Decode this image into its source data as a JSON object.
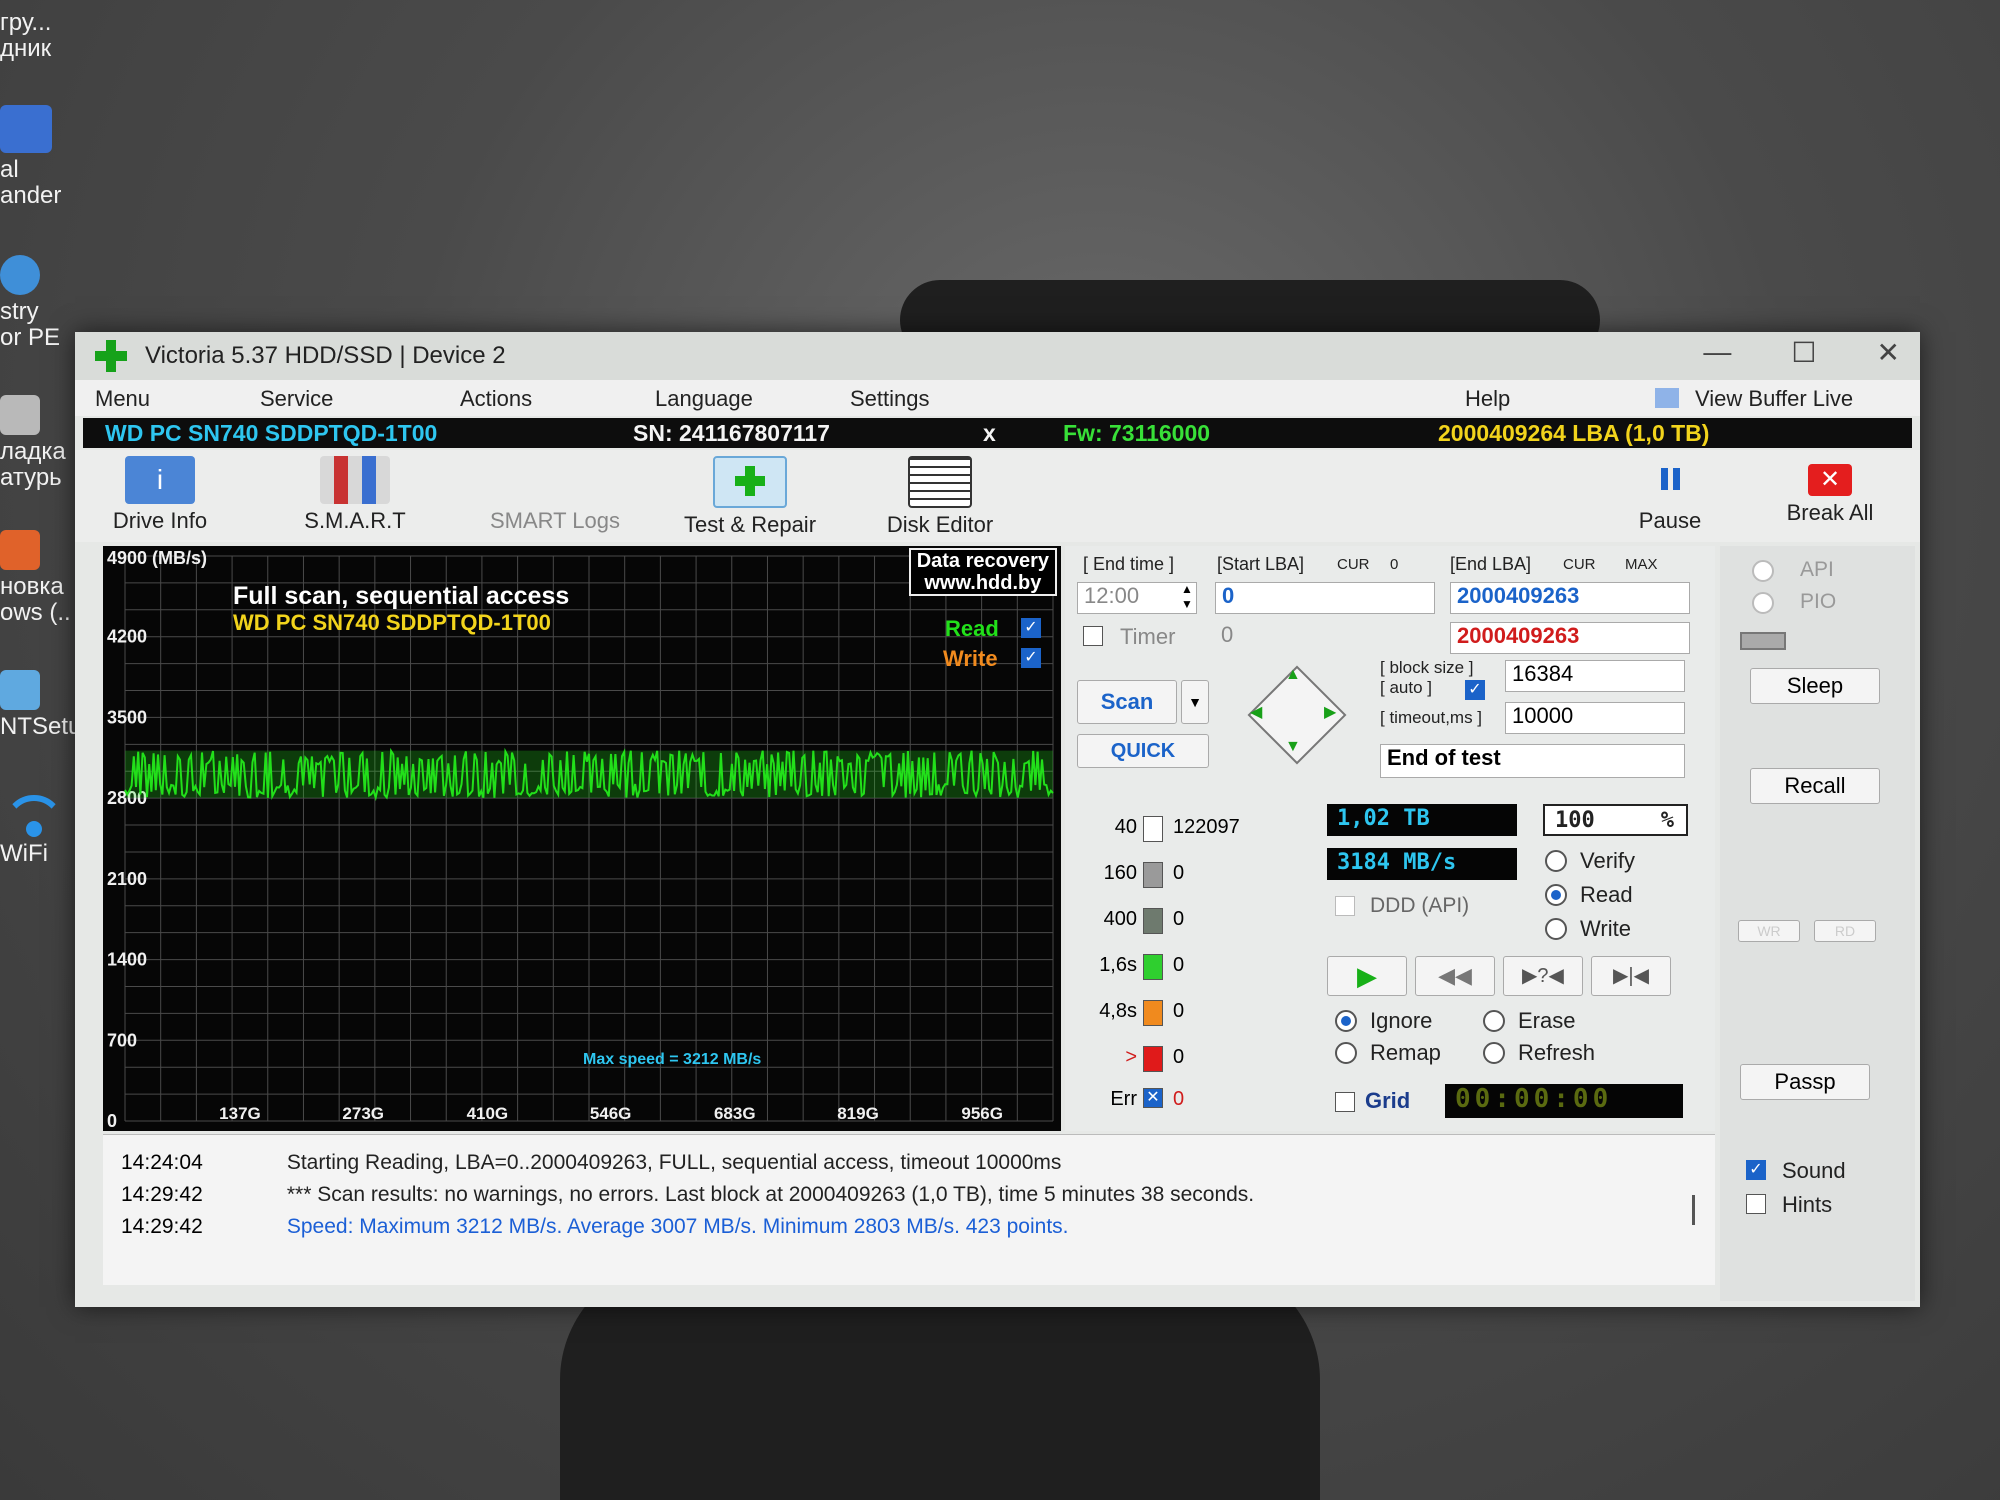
{
  "desktop": {
    "icons": [
      {
        "label": "гру...\nдник",
        "color": "#2c5fb8"
      },
      {
        "label": "al\nander",
        "color": "#3a6fd0"
      },
      {
        "label": "stry\nor PE",
        "color": "#3f8fd8"
      },
      {
        "label": "ладка\nатурь",
        "color": "#b9b9b9"
      },
      {
        "label": "новка\nows (..",
        "color": "#e0622a"
      },
      {
        "label": "NTSetup",
        "color": "#5fa9e0"
      },
      {
        "label": "WiFi",
        "color": "#2a93e8"
      }
    ]
  },
  "window": {
    "title": "Victoria 5.37 HDD/SSD | Device 2",
    "controls": {
      "minimize": "—",
      "maximize": "☐",
      "close": "✕"
    }
  },
  "menu": {
    "items": [
      "Menu",
      "Service",
      "Actions",
      "Language",
      "Settings",
      "Help"
    ],
    "view_buffer": "View Buffer Live"
  },
  "drive_info": {
    "model": "WD PC SN740 SDDPTQD-1T00",
    "serial": "SN: 241167807117",
    "close_mark": "x",
    "firmware": "Fw: 73116000",
    "capacity": "2000409264 LBA (1,0 TB)"
  },
  "toolbar": {
    "drive_info": "Drive Info",
    "smart": "S.M.A.R.T",
    "smart_logs": "SMART Logs",
    "test_repair": "Test & Repair",
    "disk_editor": "Disk Editor",
    "pause": "Pause",
    "break_all": "Break All"
  },
  "graph": {
    "unit_label": "4900 (MB/s)",
    "title": "Full scan, sequential access",
    "subtitle": "WD PC SN740 SDDPTQD-1T00",
    "promo_line1": "Data recovery",
    "promo_line2": "www.hdd.by",
    "read_label": "Read",
    "write_label": "Write",
    "max_speed_label": "Max speed = 3212 MB/s"
  },
  "chart_data": {
    "type": "area",
    "title": "Full scan, sequential access",
    "subtitle": "WD PC SN740 SDDPTQD-1T00",
    "ylabel": "4900 (MB/s)",
    "ylim": [
      0,
      4900
    ],
    "y_ticks": [
      "4900",
      "4200",
      "3500",
      "2800",
      "2100",
      "1400",
      "700",
      "0"
    ],
    "x_ticks": [
      "137G",
      "273G",
      "410G",
      "546G",
      "683G",
      "819G",
      "956G"
    ],
    "xlim": [
      0,
      1024
    ],
    "grid": true,
    "series": [
      {
        "name": "Read",
        "color": "#22e01a",
        "min": 2803,
        "max": 3212,
        "average": 3007,
        "points": 423
      }
    ]
  },
  "scan": {
    "end_time_label": "[ End time ]",
    "end_time": "12:00",
    "timer_label": "Timer",
    "timer_value": "0",
    "start_lba_label": "[Start LBA]",
    "cur_label": "CUR",
    "start_cur": "0",
    "start_lba": "0",
    "end_lba_label": "[End LBA]",
    "max_label": "MAX",
    "end_lba": "2000409263",
    "end_lba_red": "2000409263",
    "block_size_label": "[ block size ]",
    "auto_label": "[ auto ]",
    "block_size": "16384",
    "timeout_label": "[ timeout,ms ]",
    "timeout": "10000",
    "scan_button": "Scan",
    "quick_button": "QUICK",
    "end_action": "End of test"
  },
  "counters": [
    {
      "label": "40",
      "value": "122097",
      "color": "#ffffff"
    },
    {
      "label": "160",
      "value": "0",
      "color": "#9a9a9a"
    },
    {
      "label": "400",
      "value": "0",
      "color": "#6e7a6e"
    },
    {
      "label": "1,6s",
      "value": "0",
      "color": "#2fcf2f"
    },
    {
      "label": "4,8s",
      "value": "0",
      "color": "#f08a1e"
    },
    {
      "label": ">",
      "value": "0",
      "color": "#e01a1a"
    },
    {
      "label": "Err",
      "value": "0",
      "color": "#1b63c9"
    }
  ],
  "status": {
    "scanned": "1,02 TB",
    "percent": "100",
    "percent_sign": "%",
    "speed": "3184 MB/s",
    "ddd": "DDD (API)",
    "verify": "Verify",
    "read": "Read",
    "write": "Write",
    "ignore": "Ignore",
    "erase": "Erase",
    "remap": "Remap",
    "refresh": "Refresh",
    "grid": "Grid",
    "timer_display": "00:00:00"
  },
  "side": {
    "api": "API",
    "pio": "PIO",
    "sleep": "Sleep",
    "recall": "Recall",
    "wr": "WR",
    "rd": "RD",
    "passp": "Passp",
    "sound": "Sound",
    "hints": "Hints"
  },
  "log": [
    {
      "time": "14:24:04",
      "text": "Starting Reading, LBA=0..2000409263, FULL, sequential access, timeout 10000ms",
      "color": "#222222"
    },
    {
      "time": "14:29:42",
      "text": "*** Scan results: no warnings, no errors. Last block at 2000409263 (1,0 TB), time 5 minutes 38 seconds.",
      "color": "#222222"
    },
    {
      "time": "14:29:42",
      "text": "Speed: Maximum 3212 MB/s. Average 3007 MB/s. Minimum 2803 MB/s. 423 points.",
      "color": "#1b5fd6"
    }
  ]
}
